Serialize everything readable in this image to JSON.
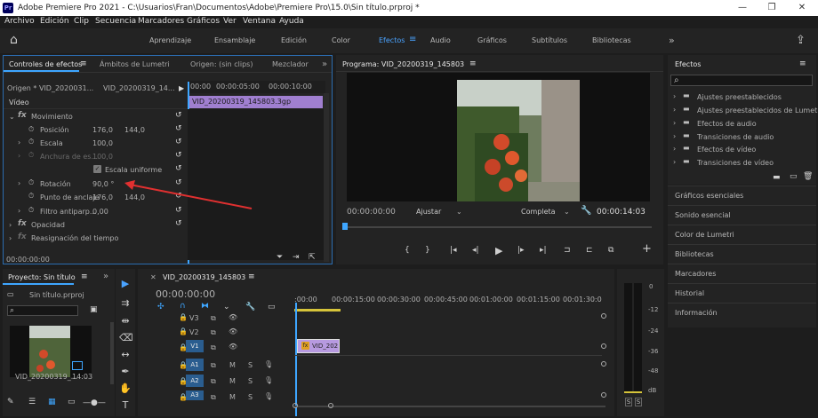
{
  "window": {
    "app_icon": "Pr",
    "title": "Adobe Premiere Pro 2021 - C:\\Usuarios\\Fran\\Documentos\\Adobe\\Premiere Pro\\15.0\\Sin título.prproj *",
    "minimize": "—",
    "maximize": "❐",
    "close": "✕"
  },
  "menu": [
    "Archivo",
    "Edición",
    "Clip",
    "Secuencia",
    "Marcadores",
    "Gráficos",
    "Ver",
    "Ventana",
    "Ayuda"
  ],
  "workspaces": {
    "home_icon": "⌂",
    "items": [
      "Aprendizaje",
      "Ensamblaje",
      "Edición",
      "Color",
      "Efectos",
      "Audio",
      "Gráficos",
      "Subtítulos",
      "Bibliotecas"
    ],
    "active_menu_icon": "≡",
    "more": "»",
    "share_icon": "⇪"
  },
  "effect_controls": {
    "tabs": [
      "Controles de efectos",
      "Ámbitos de Lumetri",
      "Origen: (sin clips)",
      "Mezclador"
    ],
    "tab_menu": "≡",
    "more": "»",
    "source": "Origen * VID_2020031...",
    "clip": "VID_20200319_14...",
    "play_arrow": "▶",
    "ruler": [
      "00:00",
      "00:00:05:00",
      "00:00:10:00"
    ],
    "clip_block": "VID_20200319_145803.3gp",
    "section": "Vídeo",
    "movimiento": "Movimiento",
    "posicion": {
      "label": "Posición",
      "x": "176,0",
      "y": "144,0"
    },
    "escala": {
      "label": "Escala",
      "value": "100,0"
    },
    "anchura": {
      "label": "Anchura de es...",
      "value": "100,0"
    },
    "uniforme": "Escala uniforme",
    "rotacion": {
      "label": "Rotación",
      "value": "90,0 °"
    },
    "anclaje": {
      "label": "Punto de anclaje",
      "x": "176,0",
      "y": "144,0"
    },
    "filtro": {
      "label": "Filtro antiparp...",
      "value": "0,00"
    },
    "opacidad": "Opacidad",
    "reasignacion": "Reasignación del tiempo",
    "fx": "fx",
    "reset_icon": "↺",
    "timecode": "00:00:00:00"
  },
  "program": {
    "title": "Programa: VID_20200319_145803",
    "tab_menu": "≡",
    "timecode": "00:00:00:00",
    "fit": "Ajustar",
    "quality": "Completa",
    "duration": "00:00:14:03",
    "controls": [
      "{",
      "}",
      "|◂",
      "◂|",
      "▶",
      "|▸",
      "▸|",
      "⊐",
      "⊏",
      "⧉"
    ],
    "plus": "+",
    "wrench_icon": "🔧"
  },
  "effects_panel": {
    "title": "Efectos",
    "tab_menu": "≡",
    "search_icon": "⌕",
    "items": [
      "Ajustes preestablecidos",
      "Ajustes preestablecidos de Lumetri",
      "Efectos de audio",
      "Transiciones de audio",
      "Efectos de vídeo",
      "Transiciones de vídeo"
    ],
    "folder_icon": "▬",
    "arrow": "›"
  },
  "right_panels": [
    "Gráficos esenciales",
    "Sonido esencial",
    "Color de Lumetri",
    "Bibliotecas",
    "Marcadores",
    "Historial",
    "Información"
  ],
  "project": {
    "tab": "Proyecto: Sin título",
    "tab_menu": "≡",
    "more": "»",
    "file": "Sin título.prproj",
    "clip_name": "VID_20200319_...",
    "clip_duration": "14:03"
  },
  "timeline": {
    "close": "✕",
    "title": "VID_20200319_145803",
    "tab_menu": "≡",
    "timecode": "00:00:00:00",
    "ruler": [
      ":00:00",
      "00:00:15:00",
      "00:00:30:00",
      "00:00:45:00",
      "00:01:00:00",
      "00:01:15:00",
      "00:01:30:0"
    ],
    "tracks": [
      "V3",
      "V2",
      "V1",
      "A1",
      "A2",
      "A3"
    ],
    "clip": "VID_202",
    "fx_badge": "fx",
    "mute": "M",
    "solo": "S"
  },
  "audio_meter": {
    "scale": [
      "0",
      "-12",
      "-24",
      "-36",
      "-48",
      "dB"
    ],
    "solo": [
      "S",
      "S"
    ]
  },
  "annotations": {
    "arrow_color": "#e03030"
  }
}
